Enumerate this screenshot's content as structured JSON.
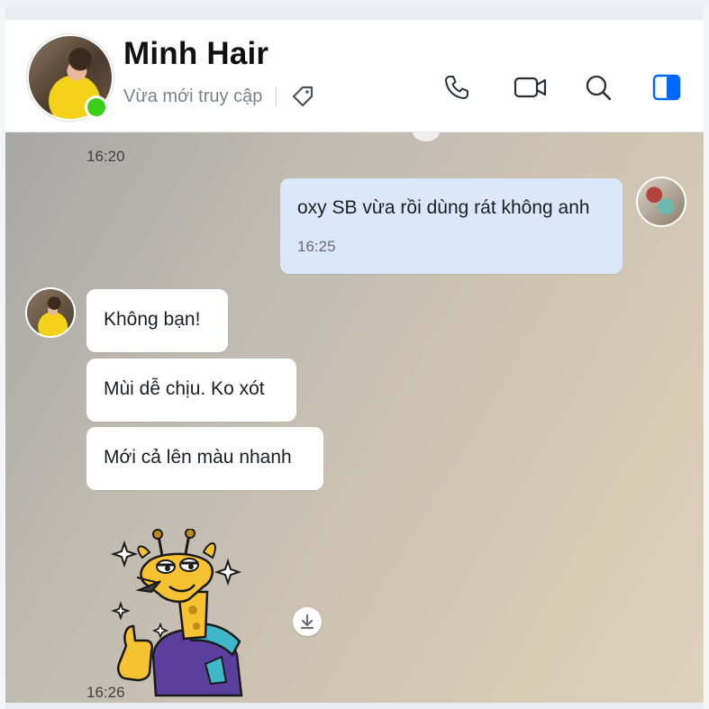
{
  "contact": {
    "name": "Minh Hair",
    "status": "Vừa mới truy cập",
    "online": true
  },
  "header_icons": [
    "phone-icon",
    "video-call-icon",
    "search-icon",
    "sidebar-toggle-icon"
  ],
  "colors": {
    "accent": "#0068ff",
    "online": "#3ccf1a",
    "bubble_in": "#ffffff",
    "bubble_out": "#dbe7fb"
  },
  "messages": [
    {
      "type": "timestamp",
      "text": "16:20"
    },
    {
      "from": "me",
      "text": "oxy SB vừa rồi dùng rát không anh",
      "time": "16:25"
    },
    {
      "from": "peer",
      "text": "Không bạn!"
    },
    {
      "from": "peer",
      "text": "Mùi dễ chịu. Ko xót"
    },
    {
      "from": "peer",
      "text": "Mới cả lên màu nhanh"
    },
    {
      "from": "peer",
      "type": "sticker",
      "sticker": "giraffe-thumbs-up"
    },
    {
      "type": "timestamp",
      "text": "16:26"
    }
  ]
}
